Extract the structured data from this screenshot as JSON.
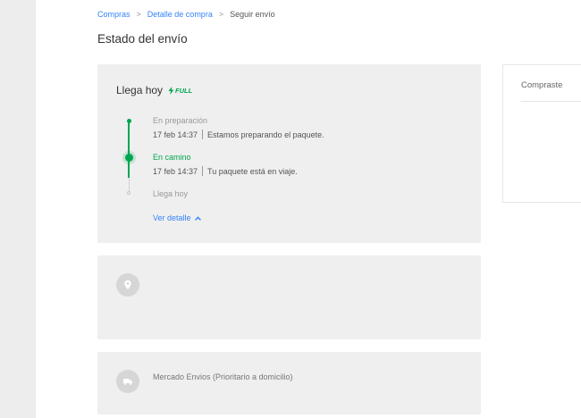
{
  "breadcrumb": {
    "items": [
      "Compras",
      "Detalle de compra"
    ],
    "separator": ">",
    "current": "Seguir envío"
  },
  "page_title": "Estado del envío",
  "shipment": {
    "arrival_title": "Llega hoy",
    "badge": "FULL",
    "steps": [
      {
        "label": "En preparación",
        "date": "17 feb 14:37",
        "message": "Estamos preparando el paquete.",
        "state": "done"
      },
      {
        "label": "En camino",
        "date": "17 feb 14:37",
        "message": "Tu paquete está en viaje.",
        "state": "current"
      },
      {
        "label": "Llega hoy",
        "state": "pending"
      }
    ],
    "detail_link": "Ver detalle"
  },
  "address": {
    "icon": "location-pin-icon"
  },
  "shipping_method": {
    "icon": "truck-icon",
    "text": "Mercado Envios (Prioritario a domicilio)"
  },
  "side_panel": {
    "title": "Compraste"
  },
  "colors": {
    "accent_green": "#00a650",
    "link_blue": "#3483fa",
    "card_bg": "#efefef"
  }
}
